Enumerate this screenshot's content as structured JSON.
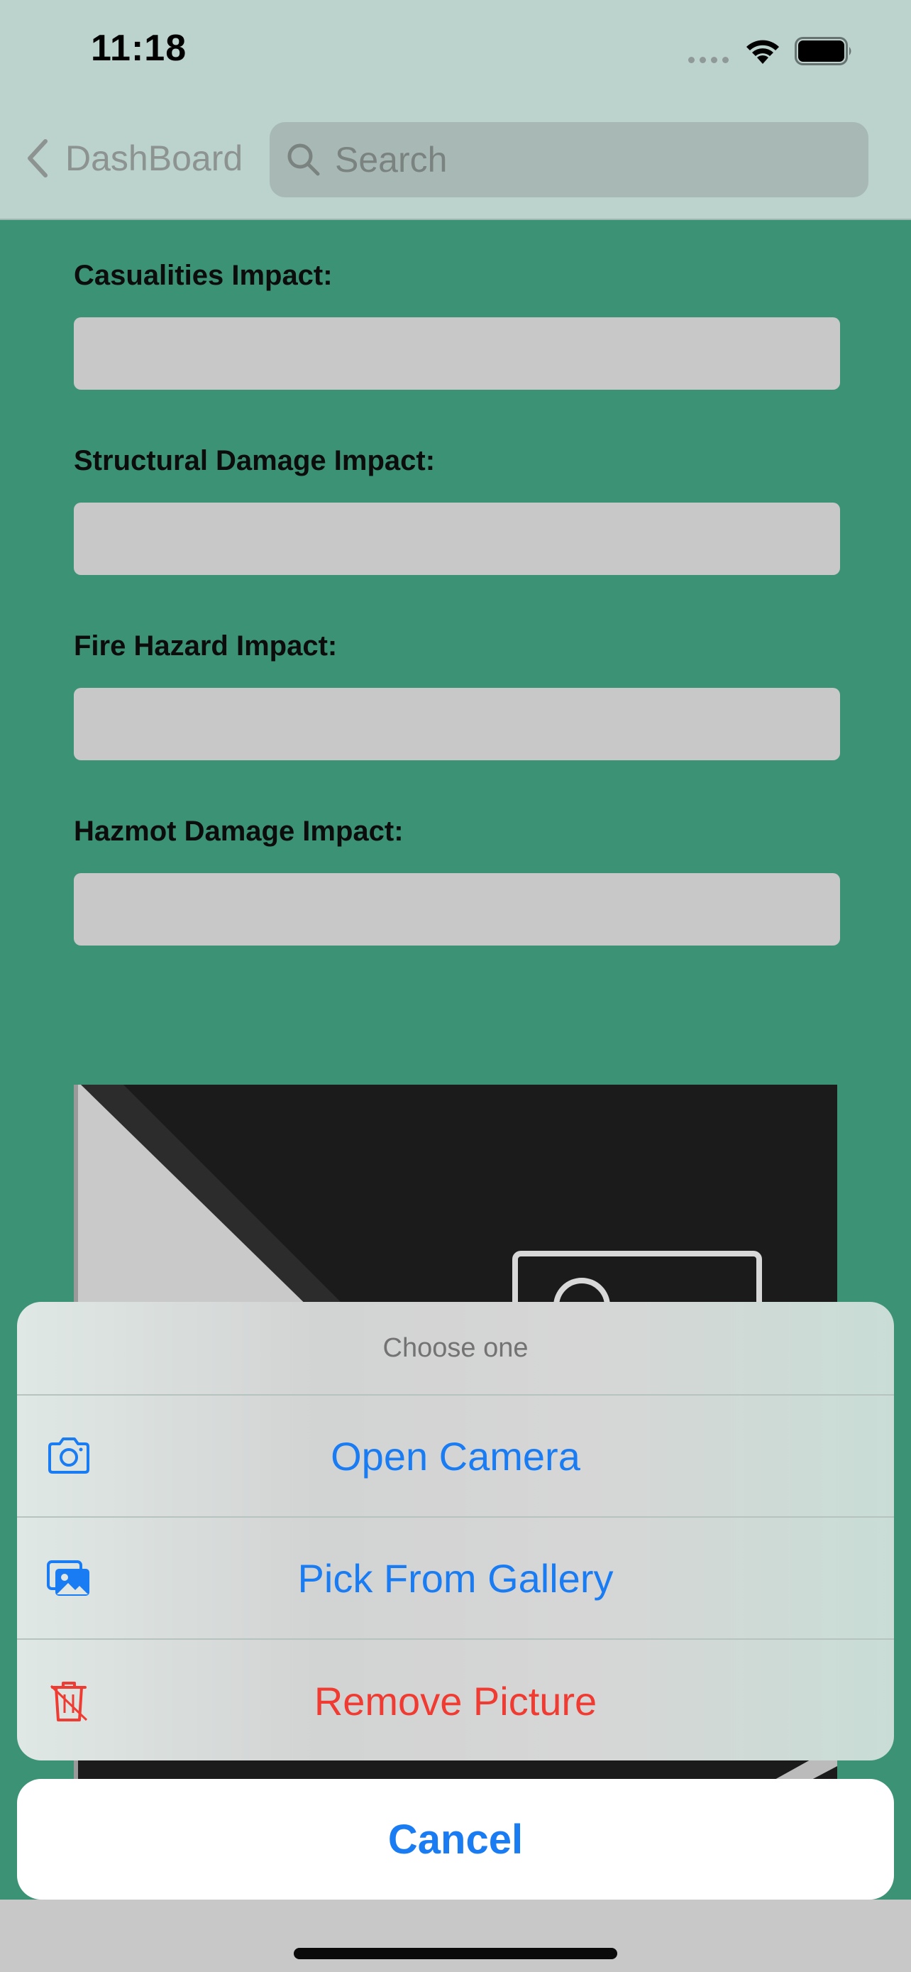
{
  "status_bar": {
    "time": "11:18",
    "icons": [
      "cellular-dots-icon",
      "wifi-icon",
      "battery-icon"
    ]
  },
  "nav": {
    "back_label": "DashBoard",
    "back_icon": "chevron-left-icon",
    "search_placeholder": "Search",
    "search_value": ""
  },
  "form": {
    "fields": [
      {
        "label": "Casualities Impact:",
        "value": ""
      },
      {
        "label": "Structural Damage Impact:",
        "value": ""
      },
      {
        "label": "Fire Hazard Impact:",
        "value": ""
      },
      {
        "label": "Hazmot Damage Impact:",
        "value": ""
      }
    ],
    "photo_icon": "image-placeholder-icon"
  },
  "action_sheet": {
    "title": "Choose one",
    "options": [
      {
        "label": "Open Camera",
        "icon": "camera-icon",
        "style": "default"
      },
      {
        "label": "Pick From Gallery",
        "icon": "gallery-icon",
        "style": "default"
      },
      {
        "label": "Remove Picture",
        "icon": "trash-icon",
        "style": "destructive"
      }
    ],
    "cancel_label": "Cancel"
  },
  "colors": {
    "accent": "#1a7cf3",
    "destructive": "#ef3b32",
    "background": "#3c9274",
    "nav_background": "#bcd2cd"
  }
}
